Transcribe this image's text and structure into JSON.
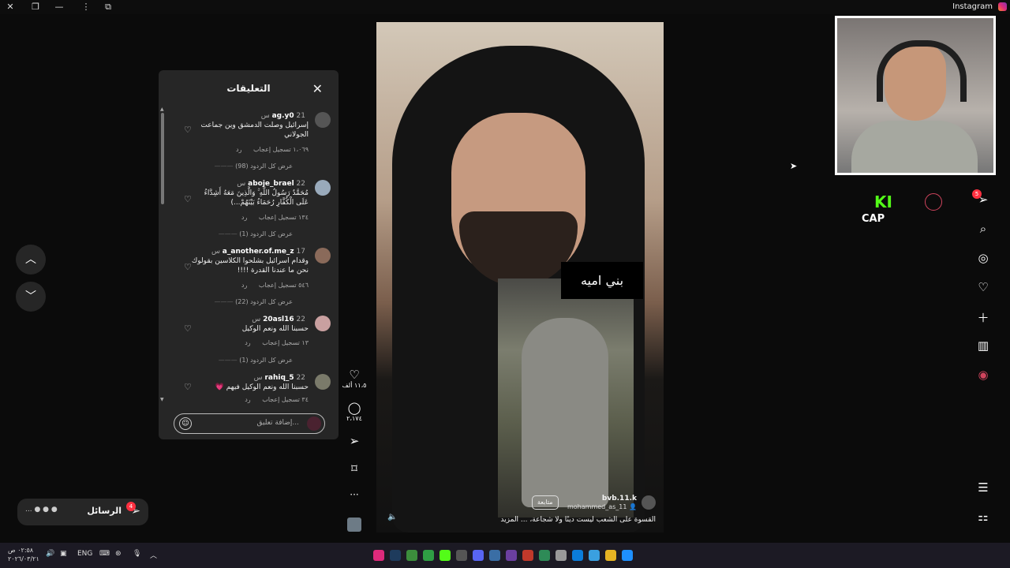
{
  "window": {
    "app_title": "Instagram"
  },
  "comments_panel": {
    "title": "التعليقات",
    "add_comment_placeholder": "إضافة تعليق...",
    "comments": [
      {
        "user": "ag.y0",
        "time": "21 س",
        "text": "إسرائيل وصلت الدمشق وين جماعت الجولاني",
        "likes": "١،٠٦٩ تسجيل إعجاب",
        "reply": "رد",
        "view_replies": "عرض كل الردود (98)"
      },
      {
        "user": "aboje_brael",
        "time": "22 س",
        "text": "مُحَمَّدٌ رَسُولُ اللَّهِ ۚ وَالَّذِينَ مَعَهُ أَشِدَّاءُ عَلَى الْكُفَّارِ رُحَمَاءُ بَيْنَهُمْ...)",
        "likes": "١٣٤ تسجيل إعجاب",
        "reply": "رد",
        "view_replies": "عرض كل الردود (1)"
      },
      {
        "user": "a_another.of.me_z",
        "time": "17 س",
        "text": "وقدام اسرائيل بشلحوا الكلاسين بقولوك نحن ما عندنا القدرة !!!!",
        "likes": "٥٤٦ تسجيل إعجاب",
        "reply": "رد",
        "view_replies": "عرض كل الردود (22)"
      },
      {
        "user": "20asl16",
        "time": "22 س",
        "text": "حسبنا الله ونعم الوكيل",
        "likes": "١٣ تسجيل إعجاب",
        "reply": "رد",
        "view_replies": "عرض كل الردود (1)"
      },
      {
        "user": "rahiq_5",
        "time": "22 س",
        "text": "حسبنا الله ونعم الوكيل فيهم 💗",
        "likes": "٣٤ تسجيل إعجاب",
        "reply": "رد",
        "view_replies": ""
      }
    ]
  },
  "actions": {
    "like_count": "١١،٥ ألف",
    "comment_count": "٢،١٧٤"
  },
  "video": {
    "overlay_text": "بني اميه",
    "owner": "bvb.11.k",
    "audio": "mohammed_as_11",
    "follow_label": "متابعة",
    "caption": "القسوة على الشعب ليست دينًا ولا شجاعة، ... المزيد"
  },
  "overlay_brand": {
    "top": "KI",
    "bottom": "CAP"
  },
  "right_nav": {
    "messages_badge": "5"
  },
  "messages": {
    "label": "الرسائل",
    "badge": "4",
    "more": "..."
  },
  "taskbar": {
    "language": "ENG",
    "time": "٠٢:٥٨ ص",
    "date": "٢٠٢٦/٠٣/٢١"
  },
  "colors": {
    "kick_green": "#53fc18",
    "badge_red": "#ff3040",
    "panel_bg": "#262626"
  }
}
